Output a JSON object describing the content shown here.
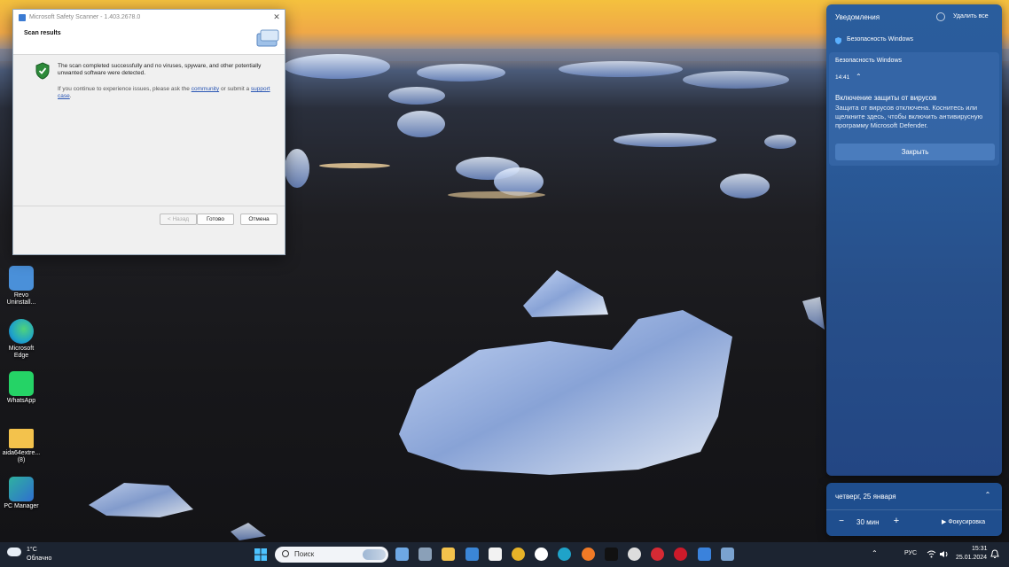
{
  "scanner": {
    "window_title": "Microsoft Safety Scanner - 1.403.2678.0",
    "header": "Scan results",
    "message": "The scan completed successfully and no viruses, spyware, and other potentially unwanted software were detected.",
    "help_prefix": "If you continue to experience issues, please ask the",
    "help_link_community": "community",
    "help_mid": "or submit a",
    "help_link_support": "support case",
    "help_suffix": ".",
    "btn_back": "< Назад",
    "btn_done": "Готово",
    "btn_cancel": "Отмена"
  },
  "notifications": {
    "header": "Уведомления",
    "clear_all": "Удалить все",
    "group_title": "Безопасность Windows",
    "card": {
      "app": "Безопасность Windows",
      "time": "14:41",
      "title": "Включение защиты от вирусов",
      "text": "Защита от вирусов отключена. Коснитесь или щелкните здесь, чтобы включить антивирусную программу Microsoft Defender.",
      "button": "Закрыть"
    }
  },
  "calendar": {
    "date": "четверг, 25 января",
    "focus_minutes": "30 мин",
    "focus_button": "Фокусировка"
  },
  "desktop_icons": [
    {
      "label": "Revo Uninstall...",
      "icon": "revo-uninstaller-icon",
      "color": "#4a90d9"
    },
    {
      "label": "Microsoft Edge",
      "icon": "edge-icon",
      "color": "#1fa3c9"
    },
    {
      "label": "WhatsApp",
      "icon": "whatsapp-icon",
      "color": "#25d366"
    },
    {
      "label": "aida64extre... (8)",
      "icon": "folder-icon",
      "color": "#f3c24c"
    },
    {
      "label": "PC Manager",
      "icon": "pc-manager-icon",
      "color": "#2fb1a0"
    }
  ],
  "taskbar": {
    "weather_temp": "1°C",
    "weather_cond": "Облачно",
    "search_placeholder": "Поиск",
    "apps": [
      {
        "name": "widgets-icon",
        "color": "#6ea8e4"
      },
      {
        "name": "task-view-icon",
        "color": "#8aa0b8"
      },
      {
        "name": "file-explorer-icon",
        "color": "#f3c24c"
      },
      {
        "name": "mail-icon",
        "color": "#3b86d6"
      },
      {
        "name": "calendar-icon",
        "color": "#f2f2f2"
      },
      {
        "name": "chrome-icon",
        "color": "#e7b328"
      },
      {
        "name": "yandex-browser-icon",
        "color": "#ffffff"
      },
      {
        "name": "edge-icon",
        "color": "#1fa3c9"
      },
      {
        "name": "firefox-icon",
        "color": "#f07a26"
      },
      {
        "name": "tiktok-icon",
        "color": "#111111"
      },
      {
        "name": "speedtest-icon",
        "color": "#dddddd"
      },
      {
        "name": "pinterest-icon",
        "color": "#d62a34"
      },
      {
        "name": "opera-icon",
        "color": "#cc1a2a"
      },
      {
        "name": "windows-security-icon",
        "color": "#3a82dc"
      },
      {
        "name": "safety-scanner-icon",
        "color": "#7aa2cf"
      }
    ],
    "lang": "РУС",
    "time": "15:31",
    "date": "25.01.2024"
  }
}
